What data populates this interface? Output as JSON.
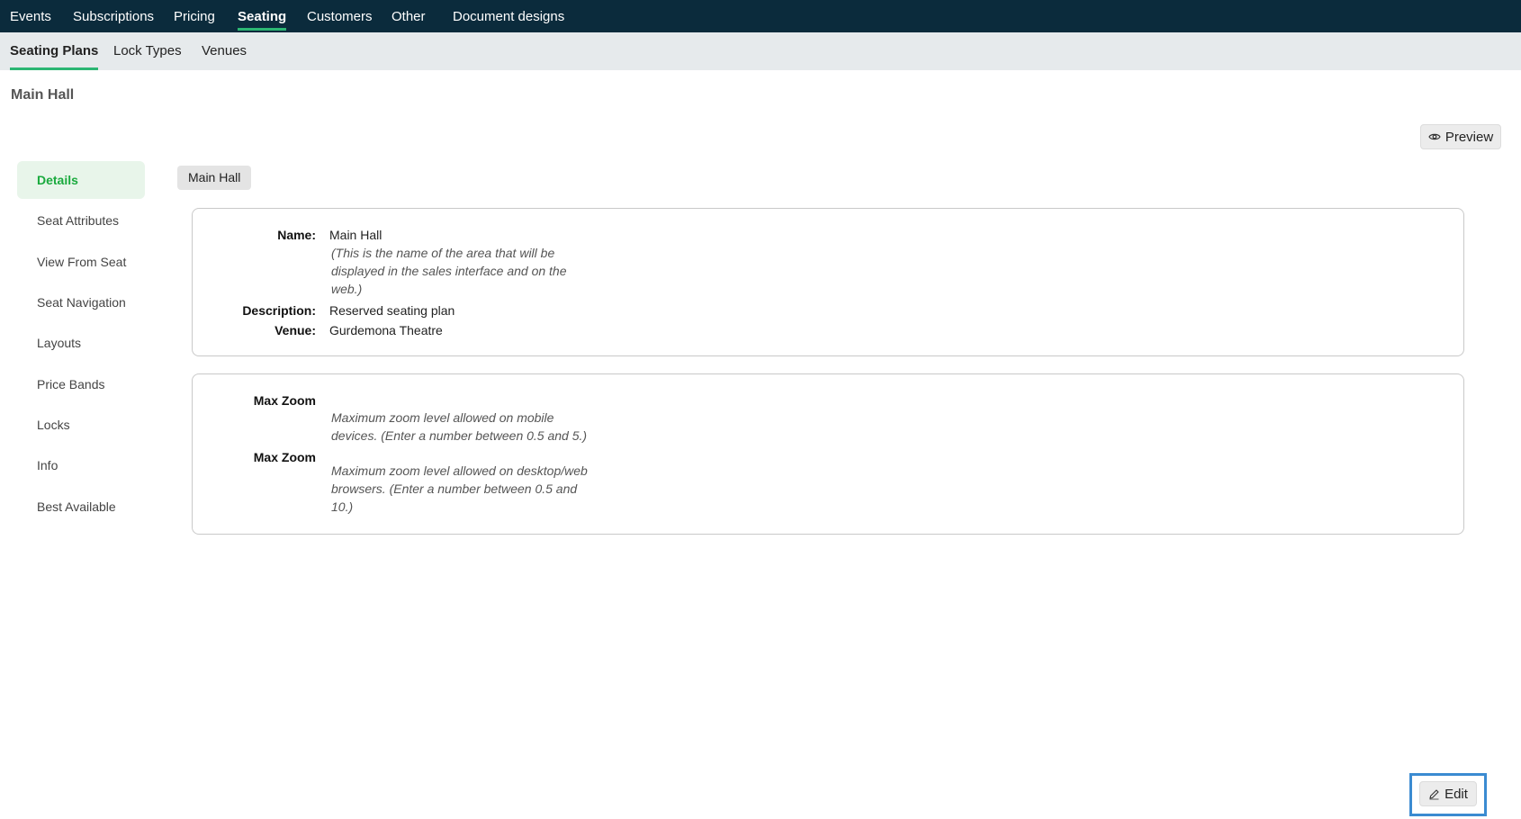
{
  "topnav": {
    "items": [
      "Events",
      "Subscriptions",
      "Pricing",
      "Seating",
      "Customers",
      "Other",
      "Document designs"
    ],
    "active": "Seating"
  },
  "subnav": {
    "items": [
      "Seating Plans",
      "Lock Types",
      "Venues"
    ],
    "active": "Seating Plans"
  },
  "page": {
    "title": "Main Hall"
  },
  "actions": {
    "preview_label": "Preview",
    "preview_icon": "eye-icon",
    "edit_label": "Edit",
    "edit_icon": "pencil-icon"
  },
  "sidemenu": {
    "items": [
      "Details",
      "Seat Attributes",
      "View From Seat",
      "Seat Navigation",
      "Layouts",
      "Price Bands",
      "Locks",
      "Info",
      "Best Available"
    ],
    "active": "Details"
  },
  "chip": {
    "label": "Main Hall"
  },
  "details": {
    "name_label": "Name:",
    "name_value": "Main Hall",
    "name_hint": "(This is the name of the area that will be displayed in the sales interface and on the web.)",
    "description_label": "Description:",
    "description_value": "Reserved seating plan",
    "venue_label": "Venue:",
    "venue_value": "Gurdemona Theatre"
  },
  "zoom": {
    "mobile_label": "Max Zoom",
    "mobile_hint": "Maximum zoom level allowed on mobile devices. (Enter a number between 0.5 and 5.)",
    "desktop_label": "Max Zoom",
    "desktop_hint": "Maximum zoom level allowed on desktop/web browsers. (Enter a number between 0.5 and 10.)"
  },
  "colors": {
    "topnav_bg": "#0b2b3c",
    "accent": "#2bb673",
    "active_side": "#1aaa3e",
    "highlight": "#3b8bd1"
  }
}
